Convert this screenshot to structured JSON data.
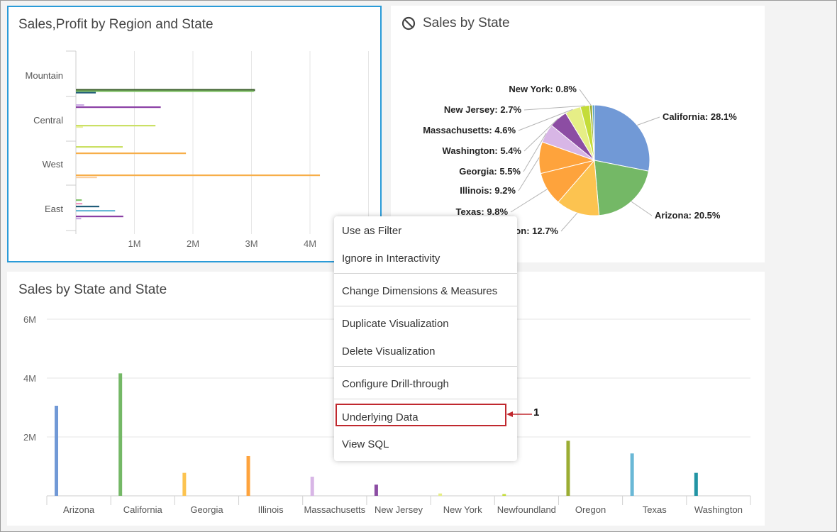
{
  "panels": {
    "region_chart": {
      "title": "Sales,Profit by Region and State"
    },
    "pie_chart": {
      "title": "Sales by State"
    },
    "bar_chart": {
      "title": "Sales by State and State"
    }
  },
  "context_menu": {
    "items": [
      "Use as Filter",
      "Ignore in Interactivity",
      "Change Dimensions & Measures",
      "Duplicate Visualization",
      "Delete Visualization",
      "Configure Drill-through",
      "Underlying Data",
      "View SQL"
    ]
  },
  "callout": {
    "label": "1",
    "color": "#c0282e"
  },
  "icons": {
    "ignore": "prohibited-icon"
  },
  "chart_data": [
    {
      "type": "bar",
      "orientation": "horizontal",
      "title": "Sales,Profit by Region and State",
      "categories": [
        "Mountain",
        "Central",
        "West",
        "East"
      ],
      "x_ticks": [
        "1M",
        "2M",
        "3M",
        "4M"
      ],
      "xlim": [
        0,
        5000000
      ],
      "bars": [
        {
          "category": "Mountain",
          "value": 3060000,
          "color": "#3b5e2b"
        },
        {
          "category": "Mountain",
          "value": 3040000,
          "color": "#84c36c"
        },
        {
          "category": "Mountain",
          "value": 340000,
          "color": "#215d7a"
        },
        {
          "category": "Central",
          "value": 140000,
          "color": "#c9a8e3"
        },
        {
          "category": "Central",
          "value": 1450000,
          "color": "#8a3fa5"
        },
        {
          "category": "Central",
          "value": 1360000,
          "color": "#cbe065"
        },
        {
          "category": "Central",
          "value": 120000,
          "color": "#e9ef9d"
        },
        {
          "category": "West",
          "value": 800000,
          "color": "#cbe065"
        },
        {
          "category": "West",
          "value": 1880000,
          "color": "#f7ae49"
        },
        {
          "category": "West",
          "value": 4170000,
          "color": "#f7ae49"
        },
        {
          "category": "West",
          "value": 360000,
          "color": "#fbcfa0"
        },
        {
          "category": "East",
          "value": 100000,
          "color": "#84c36c"
        },
        {
          "category": "East",
          "value": 110000,
          "color": "#ef9ac2"
        },
        {
          "category": "East",
          "value": 400000,
          "color": "#215d7a"
        },
        {
          "category": "East",
          "value": 670000,
          "color": "#6ab8d6"
        },
        {
          "category": "East",
          "value": 810000,
          "color": "#8a3fa5"
        },
        {
          "category": "East",
          "value": 90000,
          "color": "#c9a8e3"
        }
      ]
    },
    {
      "type": "pie",
      "title": "Sales by State",
      "slices": [
        {
          "label": "California: 28.1%",
          "value": 28.1,
          "color": "#7199d6"
        },
        {
          "label": "Arizona: 20.5%",
          "value": 20.5,
          "color": "#74b866"
        },
        {
          "label": "Oregon: 12.7%",
          "value": 12.7,
          "color": "#fcc350"
        },
        {
          "label": "Texas: 9.8%",
          "value": 9.8,
          "color": "#fea33c"
        },
        {
          "label": "Illinois: 9.2%",
          "value": 9.2,
          "color": "#fea33c"
        },
        {
          "label": "Georgia: 5.5%",
          "value": 5.5,
          "color": "#d8b6e6"
        },
        {
          "label": "Washington: 5.4%",
          "value": 5.4,
          "color": "#8c4da3"
        },
        {
          "label": "Massachusetts: 4.6%",
          "value": 4.6,
          "color": "#e6ee86"
        },
        {
          "label": "New Jersey: 2.7%",
          "value": 2.7,
          "color": "#c4dc39"
        },
        {
          "label": "New York: 0.8%",
          "value": 0.8,
          "color": "#9bad33"
        },
        {
          "label": "",
          "value": 0.6,
          "color": "#4f9ec0"
        }
      ]
    },
    {
      "type": "bar",
      "title": "Sales by State and State",
      "categories": [
        "Arizona",
        "California",
        "Georgia",
        "Illinois",
        "Massachusetts",
        "New Jersey",
        "New York",
        "Newfoundland",
        "Oregon",
        "Texas",
        "Washington"
      ],
      "values": [
        3060000,
        4160000,
        780000,
        1350000,
        650000,
        380000,
        80000,
        60000,
        1870000,
        1440000,
        780000
      ],
      "colors": [
        "#7199d6",
        "#74b866",
        "#fcc350",
        "#fea33c",
        "#d8b6e6",
        "#8c4da3",
        "#e6ee86",
        "#c4dc39",
        "#9bad33",
        "#6ab8d6",
        "#2294a4"
      ],
      "y_ticks": [
        "6M",
        "4M",
        "2M"
      ],
      "ylim": [
        0,
        6000000
      ],
      "grid": true
    }
  ]
}
